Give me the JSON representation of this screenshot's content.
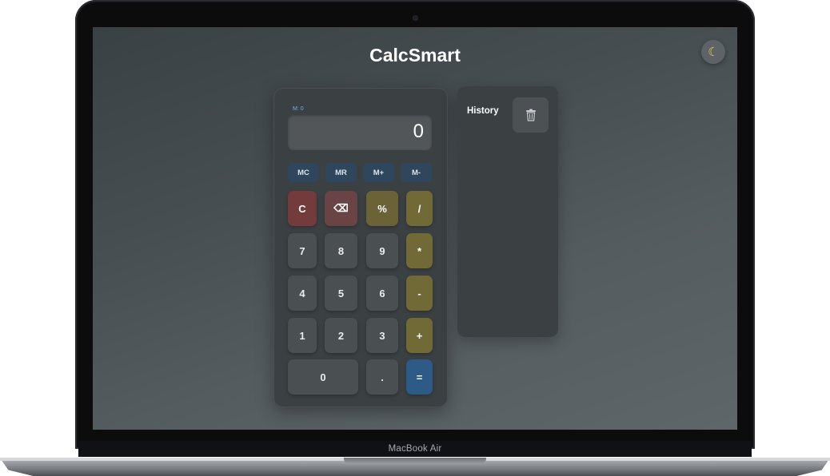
{
  "app": {
    "title": "CalcSmart",
    "theme_toggle_icon": "moon-icon"
  },
  "calculator": {
    "memory_indicator": "M: 0",
    "display_value": "0",
    "memory_buttons": [
      "MC",
      "MR",
      "M+",
      "M-"
    ],
    "rows": [
      [
        "C",
        "⌫",
        "%",
        "/"
      ],
      [
        "7",
        "8",
        "9",
        "*"
      ],
      [
        "4",
        "5",
        "6",
        "-"
      ],
      [
        "1",
        "2",
        "3",
        "+"
      ],
      [
        "0",
        ".",
        "="
      ]
    ]
  },
  "history": {
    "title": "History",
    "clear_icon": "trash-icon"
  },
  "device": {
    "label": "MacBook Air"
  },
  "colors": {
    "accent_blue": "#2d5a86",
    "clear_red": "#733b3c",
    "operator_olive": "#716a37",
    "memory_blue": "#30465c"
  }
}
